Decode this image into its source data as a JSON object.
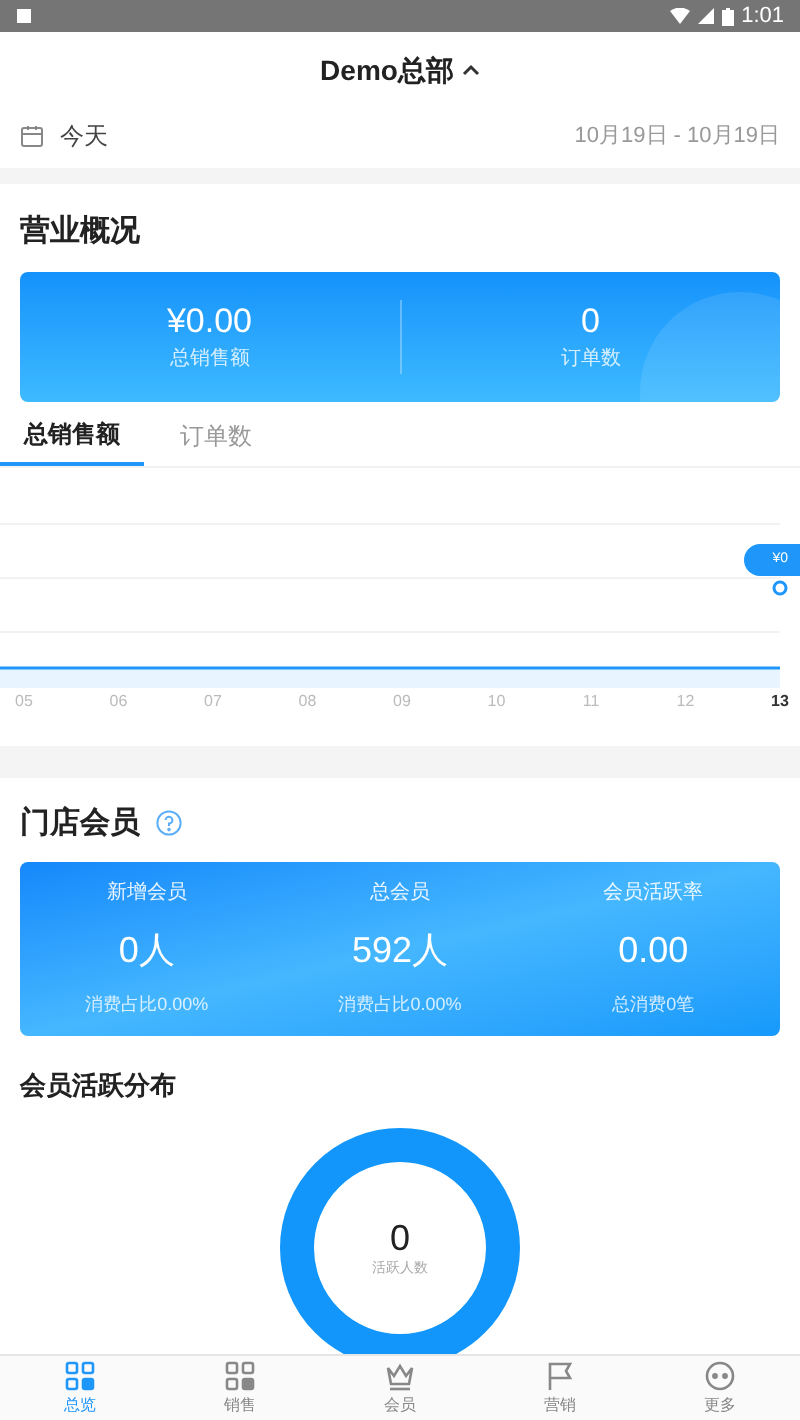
{
  "status_bar": {
    "time": "1:01"
  },
  "header": {
    "title": "Demo总部",
    "expanded": true
  },
  "date_bar": {
    "label": "今天",
    "range": "10月19日 - 10月19日"
  },
  "business": {
    "title": "营业概况",
    "stats": [
      {
        "value": "¥0.00",
        "label": "总销售额"
      },
      {
        "value": "0",
        "label": "订单数"
      }
    ],
    "tabs": [
      {
        "label": "总销售额",
        "selected": true
      },
      {
        "label": "订单数",
        "selected": false
      }
    ],
    "tooltip": "¥0",
    "x_labels": [
      {
        "label": "05",
        "selected": false
      },
      {
        "label": "06",
        "selected": false
      },
      {
        "label": "07",
        "selected": false
      },
      {
        "label": "08",
        "selected": false
      },
      {
        "label": "09",
        "selected": false
      },
      {
        "label": "10",
        "selected": false
      },
      {
        "label": "11",
        "selected": false
      },
      {
        "label": "12",
        "selected": false
      },
      {
        "label": "13",
        "selected": true
      }
    ]
  },
  "members": {
    "title": "门店会员",
    "stats": [
      {
        "label": "新增会员",
        "value": "0人",
        "note": "消费占比0.00%"
      },
      {
        "label": "总会员",
        "value": "592人",
        "note": "消费占比0.00%"
      },
      {
        "label": "会员活跃率",
        "value": "0.00",
        "note": "总消费0笔"
      }
    ]
  },
  "activity": {
    "title": "会员活跃分布",
    "value": "0",
    "label": "活跃人数"
  },
  "nav": [
    {
      "label": "总览",
      "kind": "grid",
      "selected": true
    },
    {
      "label": "销售",
      "kind": "grid",
      "selected": false
    },
    {
      "label": "会员",
      "kind": "crown",
      "selected": false
    },
    {
      "label": "营销",
      "kind": "flag",
      "selected": false
    },
    {
      "label": "更多",
      "kind": "more",
      "selected": false
    }
  ]
}
